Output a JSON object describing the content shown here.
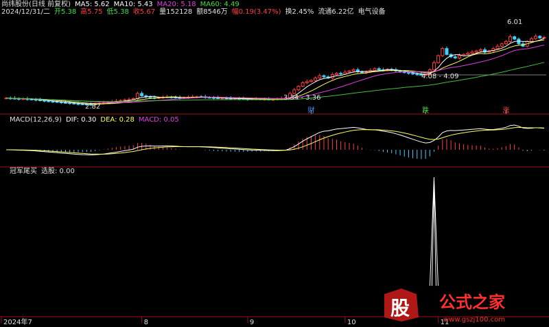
{
  "header": {
    "line1": [
      {
        "text": "尚纬股份(日线 前复权)",
        "color": "#e0e0e0"
      },
      {
        "text": "MA5: 5.62",
        "color": "#ffffff"
      },
      {
        "text": "MA10: 5.43",
        "color": "#ffffff"
      },
      {
        "text": "MA20: 5.18",
        "color": "#e040e0"
      },
      {
        "text": "MA60: 4.49",
        "color": "#40e040"
      }
    ],
    "line2": [
      {
        "text": "2024/12/31/二",
        "color": "#e0e0e0"
      },
      {
        "text": "开5.38",
        "color": "#40e040"
      },
      {
        "text": "高5.75",
        "color": "#ff4040"
      },
      {
        "text": "低5.38",
        "color": "#40e040"
      },
      {
        "text": "收5.67",
        "color": "#ff4040"
      },
      {
        "text": "量152128",
        "color": "#e0e0e0"
      },
      {
        "text": "额8546万",
        "color": "#e0e0e0"
      },
      {
        "text": "幅0.19(3.47%)",
        "color": "#ff4040"
      },
      {
        "text": "换2.45%",
        "color": "#e0e0e0"
      },
      {
        "text": "流通6.22亿",
        "color": "#e0e0e0"
      },
      {
        "text": "电气设备",
        "color": "#e0e0e0"
      }
    ]
  },
  "price_annotations": {
    "low_1": "2.82",
    "low_2": "3.34 - 3.36",
    "range": "4.08 - 4.09",
    "high": "6.01"
  },
  "event_markers": [
    {
      "label": "财",
      "color": "#4090ff"
    },
    {
      "label": "跌",
      "color": "#40e040"
    },
    {
      "label": "涨",
      "color": "#ff4040"
    }
  ],
  "macd_header": [
    {
      "text": "MACD(12,26,9)",
      "color": "#e0e0e0"
    },
    {
      "text": "DIF: 0.30",
      "color": "#ffffff"
    },
    {
      "text": "DEA: 0.28",
      "color": "#ffff60"
    },
    {
      "text": "MACD: 0.05",
      "color": "#e040e0"
    }
  ],
  "indicator_header": [
    {
      "text": "冠军尾买",
      "color": "#e0e0e0"
    },
    {
      "text": "选股: 0.00",
      "color": "#e0e0e0"
    }
  ],
  "x_axis": [
    "2024年7",
    "8",
    "9",
    "10",
    "11"
  ],
  "watermark": {
    "char": "股",
    "text": "公式之家",
    "url": "www.gszj100.com"
  },
  "colors": {
    "up": "#ff4040",
    "down": "#40d0ff",
    "ma5": "#ffffff",
    "ma10": "#ffff60",
    "ma20": "#e040e0",
    "ma60": "#40c040",
    "divider": "#a01010"
  },
  "chart_data": {
    "type": "candlestick",
    "symbol": "尚纬股份",
    "period": "日线 前复权",
    "last_date": "2024/12/31",
    "y_price_range": [
      2.6,
      6.5
    ],
    "close_series": [
      3.1,
      3.09,
      3.08,
      3.06,
      3.07,
      3.05,
      3.04,
      3.02,
      3.0,
      2.98,
      2.96,
      2.95,
      2.93,
      2.91,
      2.9,
      2.88,
      2.86,
      2.85,
      2.84,
      2.83,
      2.82,
      2.86,
      2.88,
      2.9,
      2.93,
      2.95,
      2.97,
      3.0,
      3.02,
      3.04,
      3.08,
      3.3,
      3.2,
      3.15,
      3.12,
      3.1,
      3.12,
      3.14,
      3.15,
      3.14,
      3.12,
      3.1,
      3.12,
      3.14,
      3.15,
      3.16,
      3.15,
      3.13,
      3.12,
      3.11,
      3.1,
      3.1,
      3.09,
      3.08,
      3.08,
      3.07,
      3.06,
      3.05,
      3.06,
      3.06,
      3.05,
      3.05,
      3.04,
      3.04,
      3.06,
      3.08,
      3.1,
      3.3,
      3.45,
      3.6,
      3.75,
      3.8,
      3.85,
      3.95,
      4.05,
      4.0,
      3.95,
      4.1,
      4.15,
      4.12,
      4.2,
      4.25,
      4.3,
      4.22,
      4.18,
      4.2,
      4.28,
      4.35,
      4.3,
      4.28,
      4.32,
      4.3,
      4.25,
      4.22,
      4.18,
      4.15,
      4.12,
      4.1,
      4.08,
      4.1,
      4.3,
      4.6,
      4.9,
      5.2,
      4.95,
      4.85,
      4.8,
      4.9,
      4.95,
      5.0,
      5.05,
      5.1,
      5.15,
      5.05,
      5.1,
      5.2,
      5.3,
      5.4,
      5.5,
      5.7,
      5.6,
      5.4,
      5.3,
      5.5,
      5.62,
      5.72,
      5.65,
      5.67
    ],
    "ma_values": {
      "MA5": 5.62,
      "MA10": 5.43,
      "MA20": 5.18,
      "MA60": 4.49
    },
    "macd": {
      "DIF": 0.3,
      "DEA": 0.28,
      "MACD": 0.05,
      "params": [
        12,
        26,
        9
      ]
    },
    "indicator": {
      "name": "冠军尾买",
      "value": 0.0,
      "signal_index": 101
    }
  }
}
